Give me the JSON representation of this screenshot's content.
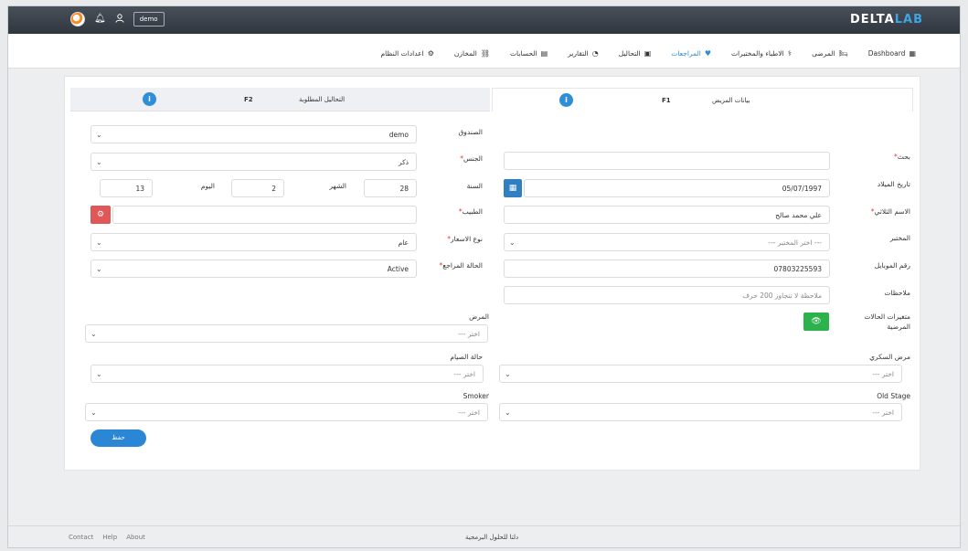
{
  "brand": {
    "part1": "DELTA",
    "part2": "LAB"
  },
  "topbar": {
    "user_label": "demo"
  },
  "menu": [
    {
      "label": "Dashboard",
      "icon": "dashboard-icon",
      "glyph": "▦",
      "active": false
    },
    {
      "label": "المرضى",
      "icon": "bed-icon",
      "glyph": "🛏",
      "active": false
    },
    {
      "label": "الاطباء والمختبرات",
      "icon": "doctor-icon",
      "glyph": "⚕",
      "active": false
    },
    {
      "label": "المراجعات",
      "icon": "heart-icon",
      "glyph": "♥",
      "active": true
    },
    {
      "label": "التحاليل",
      "icon": "briefcase-icon",
      "glyph": "▣",
      "active": false
    },
    {
      "label": "التقارير",
      "icon": "pie-chart-icon",
      "glyph": "◔",
      "active": false
    },
    {
      "label": "الحسابات",
      "icon": "accounts-icon",
      "glyph": "▤",
      "active": false
    },
    {
      "label": "المخازن",
      "icon": "warehouse-icon",
      "glyph": "⛓",
      "active": false
    },
    {
      "label": "اعدادات النظام",
      "icon": "gear-icon",
      "glyph": "⚙",
      "active": false
    }
  ],
  "tabs": {
    "right": {
      "label": "بيانات المريض",
      "key": "F1"
    },
    "left": {
      "label": "التحاليل المطلوبة",
      "key": "F2"
    }
  },
  "form": {
    "search_label": "بحث",
    "search_value": "",
    "birth_date_label": "تاريخ الميلاد",
    "birth_date_value": "05/07/1997",
    "full_name_label": "الاسم الثلاثي",
    "full_name_value": "علي محمد صالح",
    "lab_label": "المختبر",
    "lab_value": "--- اختر المختبر ---",
    "mobile_label": "رقم الموبايل",
    "mobile_value": "07803225593",
    "notes_label": "ملاحظات",
    "notes_placeholder": "ملاحظة لا تتجاوز 200 حرف",
    "case_vars_label_1": "متغيرات الحالات",
    "case_vars_label_2": "المرضية",
    "box_label": "الصندوق",
    "box_value": "demo",
    "gender_label": "الجنس",
    "gender_value": "ذكر",
    "year_label": "السنة",
    "year_value": "28",
    "month_label": "الشهر",
    "month_value": "2",
    "day_label": "اليوم",
    "day_value": "13",
    "doctor_label": "الطبيب",
    "doctor_value": "",
    "price_type_label": "نوع الاسعار",
    "price_type_value": "عام",
    "visit_status_label": "الحالة المراجع",
    "visit_status_value": "Active",
    "disease_label": "المرض",
    "disease_value": "--- اختر",
    "diabetes_label": "مرض السكري",
    "diabetes_value": "--- اختر",
    "fasting_label": "حالة الصيام",
    "fasting_value": "--- اختر",
    "old_stage_label": "Old Stage",
    "old_stage_value": "--- اختر",
    "smoker_label": "Smoker",
    "smoker_value": "--- اختر",
    "required_mark": "*",
    "save_label": "حفظ"
  },
  "footer": {
    "links": [
      "Contact",
      "Help",
      "About"
    ],
    "center": "دلتا للحلول البرمجية"
  },
  "colors": {
    "topbar": "#3a414a",
    "accent": "#2c86d6",
    "danger": "#e05757",
    "success": "#2bb24c"
  }
}
